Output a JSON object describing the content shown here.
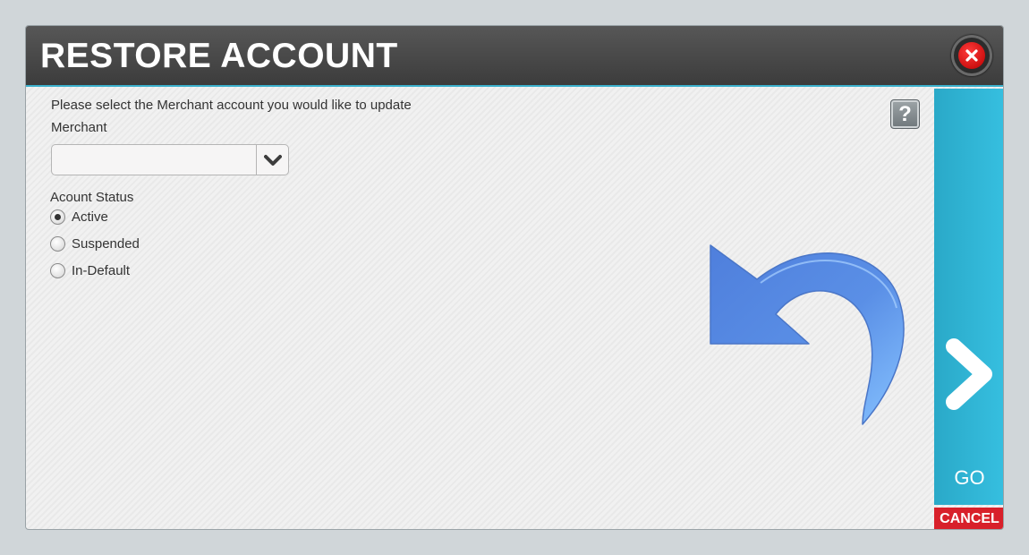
{
  "dialog": {
    "title": "RESTORE ACCOUNT",
    "close_icon": "close-icon"
  },
  "form": {
    "instructions": "Please select the Merchant account you would like to update",
    "merchant_label": "Merchant",
    "merchant_value": "",
    "status_label": "Acount Status",
    "status_options": [
      {
        "label": "Active",
        "checked": true
      },
      {
        "label": "Suspended",
        "checked": false
      },
      {
        "label": "In-Default",
        "checked": false
      }
    ]
  },
  "help": {
    "label": "?"
  },
  "actions": {
    "go_label": "GO",
    "cancel_label": "CANCEL"
  },
  "colors": {
    "accent": "#36bfe0",
    "cancel": "#d8202a",
    "titlebar": "#3c3c3c",
    "arrow": "#5b8de0"
  }
}
